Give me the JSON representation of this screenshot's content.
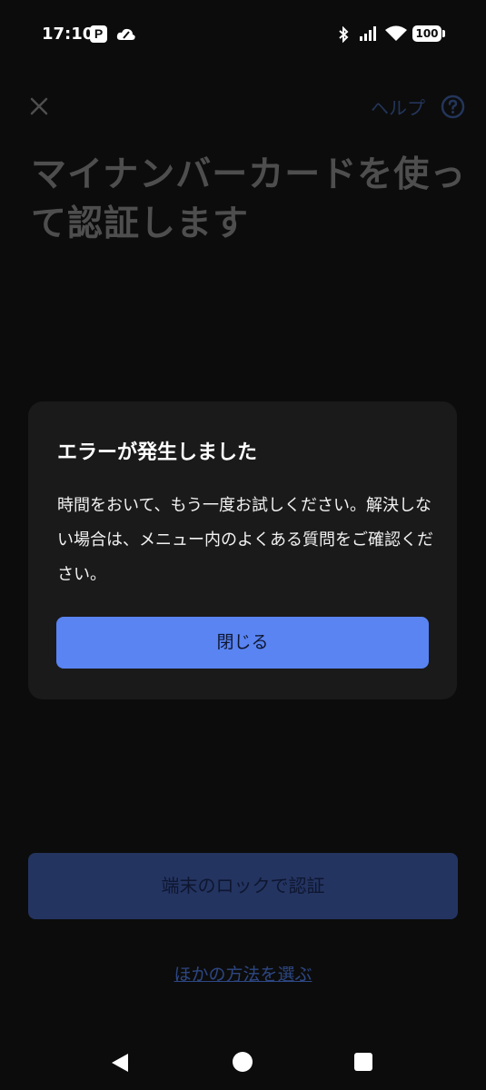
{
  "status_bar": {
    "time": "17:10",
    "app_icon_letter": "P",
    "battery": "100"
  },
  "header": {
    "close_icon": "close-icon",
    "help_label": "ヘルプ",
    "help_icon": "help-circle-icon"
  },
  "page": {
    "title": "マイナンバーカードを使って認証します"
  },
  "dialog": {
    "title": "エラーが発生しました",
    "message": "時間をおいて、もう一度お試しください。解決しない場合は、メニュー内のよくある質問をご確認ください。",
    "close_label": "閉じる"
  },
  "actions": {
    "lock_auth_label": "端末のロックで認証",
    "other_method_label": "ほかの方法を選ぶ"
  },
  "colors": {
    "background": "#0c0c0c",
    "dialog_bg": "#1a1a1a",
    "accent": "#5984f2",
    "accent_dim": "#243461"
  }
}
